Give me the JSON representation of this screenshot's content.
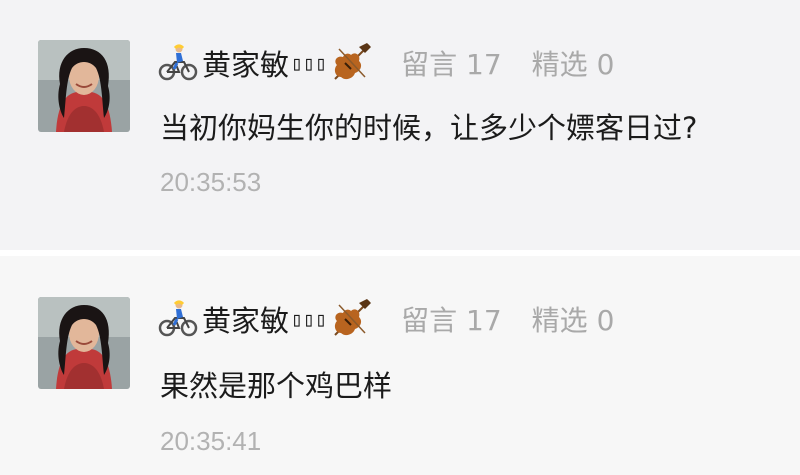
{
  "comments": [
    {
      "author": "黄家敏",
      "author_suffix_glyphs": "▯▯▯",
      "author_leading_icon": "cyclist-icon",
      "author_trailing_icon": "violin-icon",
      "stat_comments": "留言 17",
      "stat_selected": "精选 0",
      "text": "当初你妈生你的时候，让多少个嫖客日过?",
      "time": "20:35:53"
    },
    {
      "author": "黄家敏",
      "author_suffix_glyphs": "▯▯▯",
      "author_leading_icon": "cyclist-icon",
      "author_trailing_icon": "violin-icon",
      "stat_comments": "留言 17",
      "stat_selected": "精选 0",
      "text": "果然是那个鸡巴样",
      "time": "20:35:41"
    }
  ],
  "colors": {
    "background": "#f3f3f5",
    "text": "#1b1b1b",
    "meta": "#a9a9a9",
    "time": "#b2b2b2"
  }
}
